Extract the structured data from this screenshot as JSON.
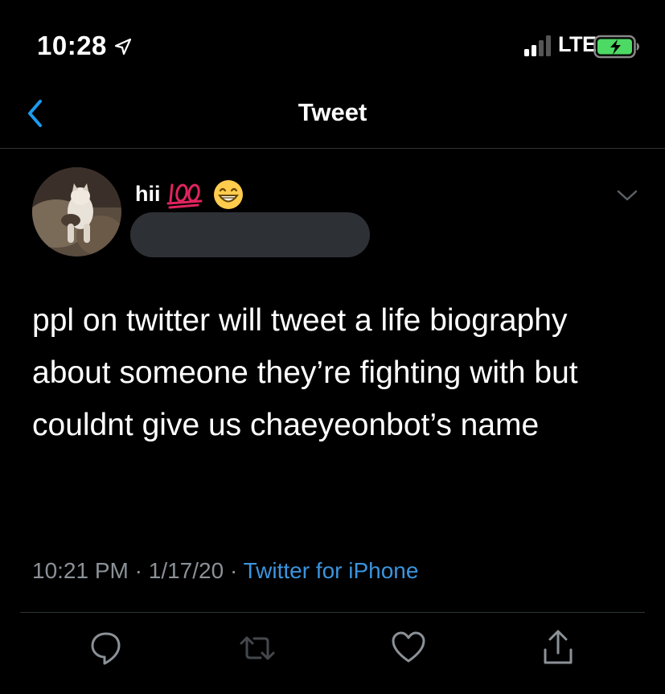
{
  "status_bar": {
    "time": "10:28",
    "carrier": "LTE",
    "icons": [
      "location-arrow-icon",
      "signal-bars-icon",
      "battery-charging-icon"
    ]
  },
  "nav": {
    "title": "Tweet",
    "back_icon": "chevron-left-icon"
  },
  "tweet": {
    "author": {
      "display_name": "hii",
      "name_emoji": [
        "hundred-points-icon",
        "grinning-face-icon"
      ],
      "avatar": "avatar-cat-photo",
      "handle_redacted": true
    },
    "text": "ppl on twitter will tweet a life biography about someone they’re fighting with but couldnt give us chaeyeonbot’s name",
    "timestamp": "10:21 PM",
    "separator": "·",
    "date": "1/17/20",
    "source": "Twitter for iPhone"
  },
  "actions": [
    {
      "name": "reply",
      "icon": "reply-icon"
    },
    {
      "name": "retweet",
      "icon": "retweet-icon"
    },
    {
      "name": "like",
      "icon": "heart-icon"
    },
    {
      "name": "share",
      "icon": "share-icon"
    }
  ],
  "colors": {
    "background": "#000000",
    "text": "#ffffff",
    "secondary": "#8b9197",
    "link": "#3b94de",
    "divider": "#2f3336",
    "redaction": "#2d3034"
  }
}
